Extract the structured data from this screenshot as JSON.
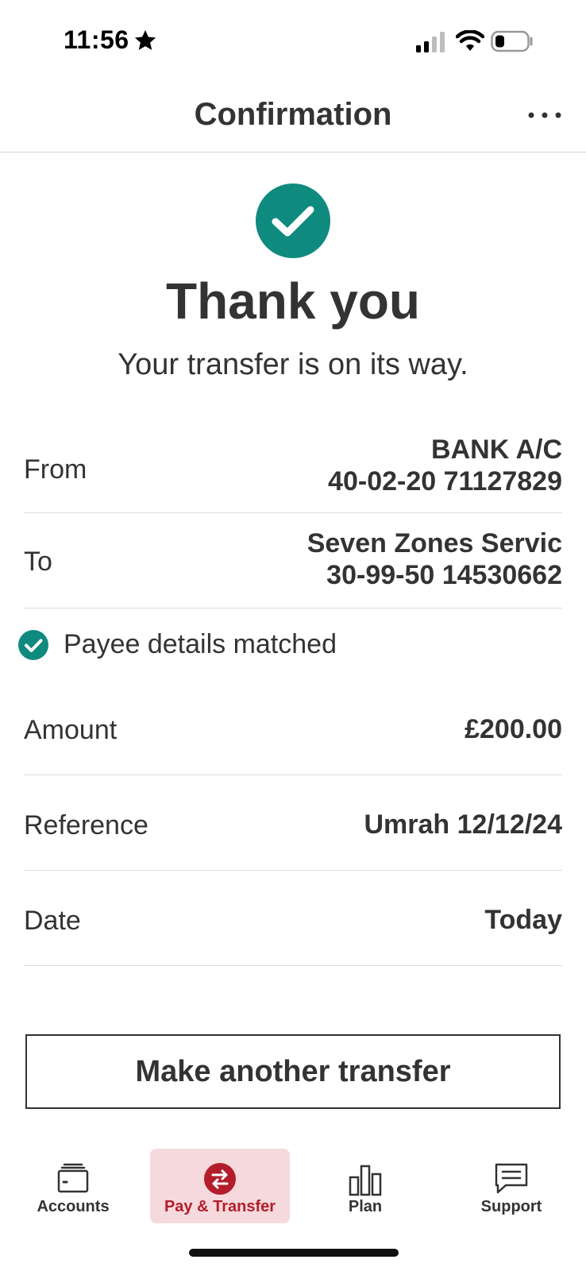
{
  "status_bar": {
    "time": "11:56"
  },
  "header": {
    "title": "Confirmation"
  },
  "success": {
    "title": "Thank you",
    "subtitle": "Your transfer is on its way."
  },
  "details": {
    "from": {
      "label": "From",
      "line1": "BANK A/C",
      "line2": "40-02-20 71127829"
    },
    "to": {
      "label": "To",
      "line1": "Seven Zones Servic",
      "line2": "30-99-50 14530662"
    },
    "payee_status": "Payee details matched",
    "amount": {
      "label": "Amount",
      "value": "£200.00"
    },
    "reference": {
      "label": "Reference",
      "value": "Umrah 12/12/24"
    },
    "date": {
      "label": "Date",
      "value": "Today"
    }
  },
  "cta": {
    "label": "Make another transfer"
  },
  "tabs": [
    {
      "label": "Accounts",
      "icon": "wallet-icon",
      "active": false
    },
    {
      "label": "Pay & Transfer",
      "icon": "transfer-arrows-icon",
      "active": true
    },
    {
      "label": "Plan",
      "icon": "bar-chart-icon",
      "active": false
    },
    {
      "label": "Support",
      "icon": "chat-bubble-icon",
      "active": false
    }
  ],
  "colors": {
    "accent_teal": "#0f8a7e",
    "brand_red": "#b31d2b",
    "active_tab_bg": "#f6d9dc",
    "text": "#333333"
  }
}
